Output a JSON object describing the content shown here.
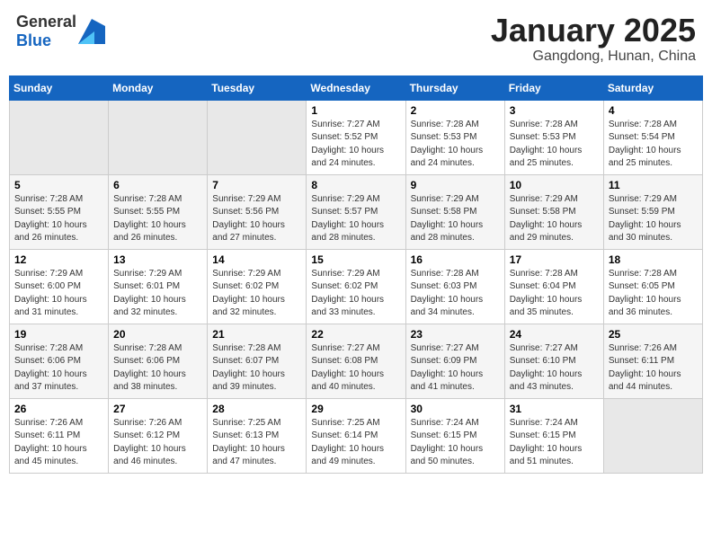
{
  "header": {
    "logo_general": "General",
    "logo_blue": "Blue",
    "title": "January 2025",
    "subtitle": "Gangdong, Hunan, China"
  },
  "weekdays": [
    "Sunday",
    "Monday",
    "Tuesday",
    "Wednesday",
    "Thursday",
    "Friday",
    "Saturday"
  ],
  "weeks": [
    [
      {
        "day": "",
        "info": ""
      },
      {
        "day": "",
        "info": ""
      },
      {
        "day": "",
        "info": ""
      },
      {
        "day": "1",
        "info": "Sunrise: 7:27 AM\nSunset: 5:52 PM\nDaylight: 10 hours and 24 minutes."
      },
      {
        "day": "2",
        "info": "Sunrise: 7:28 AM\nSunset: 5:53 PM\nDaylight: 10 hours and 24 minutes."
      },
      {
        "day": "3",
        "info": "Sunrise: 7:28 AM\nSunset: 5:53 PM\nDaylight: 10 hours and 25 minutes."
      },
      {
        "day": "4",
        "info": "Sunrise: 7:28 AM\nSunset: 5:54 PM\nDaylight: 10 hours and 25 minutes."
      }
    ],
    [
      {
        "day": "5",
        "info": "Sunrise: 7:28 AM\nSunset: 5:55 PM\nDaylight: 10 hours and 26 minutes."
      },
      {
        "day": "6",
        "info": "Sunrise: 7:28 AM\nSunset: 5:55 PM\nDaylight: 10 hours and 26 minutes."
      },
      {
        "day": "7",
        "info": "Sunrise: 7:29 AM\nSunset: 5:56 PM\nDaylight: 10 hours and 27 minutes."
      },
      {
        "day": "8",
        "info": "Sunrise: 7:29 AM\nSunset: 5:57 PM\nDaylight: 10 hours and 28 minutes."
      },
      {
        "day": "9",
        "info": "Sunrise: 7:29 AM\nSunset: 5:58 PM\nDaylight: 10 hours and 28 minutes."
      },
      {
        "day": "10",
        "info": "Sunrise: 7:29 AM\nSunset: 5:58 PM\nDaylight: 10 hours and 29 minutes."
      },
      {
        "day": "11",
        "info": "Sunrise: 7:29 AM\nSunset: 5:59 PM\nDaylight: 10 hours and 30 minutes."
      }
    ],
    [
      {
        "day": "12",
        "info": "Sunrise: 7:29 AM\nSunset: 6:00 PM\nDaylight: 10 hours and 31 minutes."
      },
      {
        "day": "13",
        "info": "Sunrise: 7:29 AM\nSunset: 6:01 PM\nDaylight: 10 hours and 32 minutes."
      },
      {
        "day": "14",
        "info": "Sunrise: 7:29 AM\nSunset: 6:02 PM\nDaylight: 10 hours and 32 minutes."
      },
      {
        "day": "15",
        "info": "Sunrise: 7:29 AM\nSunset: 6:02 PM\nDaylight: 10 hours and 33 minutes."
      },
      {
        "day": "16",
        "info": "Sunrise: 7:28 AM\nSunset: 6:03 PM\nDaylight: 10 hours and 34 minutes."
      },
      {
        "day": "17",
        "info": "Sunrise: 7:28 AM\nSunset: 6:04 PM\nDaylight: 10 hours and 35 minutes."
      },
      {
        "day": "18",
        "info": "Sunrise: 7:28 AM\nSunset: 6:05 PM\nDaylight: 10 hours and 36 minutes."
      }
    ],
    [
      {
        "day": "19",
        "info": "Sunrise: 7:28 AM\nSunset: 6:06 PM\nDaylight: 10 hours and 37 minutes."
      },
      {
        "day": "20",
        "info": "Sunrise: 7:28 AM\nSunset: 6:06 PM\nDaylight: 10 hours and 38 minutes."
      },
      {
        "day": "21",
        "info": "Sunrise: 7:28 AM\nSunset: 6:07 PM\nDaylight: 10 hours and 39 minutes."
      },
      {
        "day": "22",
        "info": "Sunrise: 7:27 AM\nSunset: 6:08 PM\nDaylight: 10 hours and 40 minutes."
      },
      {
        "day": "23",
        "info": "Sunrise: 7:27 AM\nSunset: 6:09 PM\nDaylight: 10 hours and 41 minutes."
      },
      {
        "day": "24",
        "info": "Sunrise: 7:27 AM\nSunset: 6:10 PM\nDaylight: 10 hours and 43 minutes."
      },
      {
        "day": "25",
        "info": "Sunrise: 7:26 AM\nSunset: 6:11 PM\nDaylight: 10 hours and 44 minutes."
      }
    ],
    [
      {
        "day": "26",
        "info": "Sunrise: 7:26 AM\nSunset: 6:11 PM\nDaylight: 10 hours and 45 minutes."
      },
      {
        "day": "27",
        "info": "Sunrise: 7:26 AM\nSunset: 6:12 PM\nDaylight: 10 hours and 46 minutes."
      },
      {
        "day": "28",
        "info": "Sunrise: 7:25 AM\nSunset: 6:13 PM\nDaylight: 10 hours and 47 minutes."
      },
      {
        "day": "29",
        "info": "Sunrise: 7:25 AM\nSunset: 6:14 PM\nDaylight: 10 hours and 49 minutes."
      },
      {
        "day": "30",
        "info": "Sunrise: 7:24 AM\nSunset: 6:15 PM\nDaylight: 10 hours and 50 minutes."
      },
      {
        "day": "31",
        "info": "Sunrise: 7:24 AM\nSunset: 6:15 PM\nDaylight: 10 hours and 51 minutes."
      },
      {
        "day": "",
        "info": ""
      }
    ]
  ]
}
